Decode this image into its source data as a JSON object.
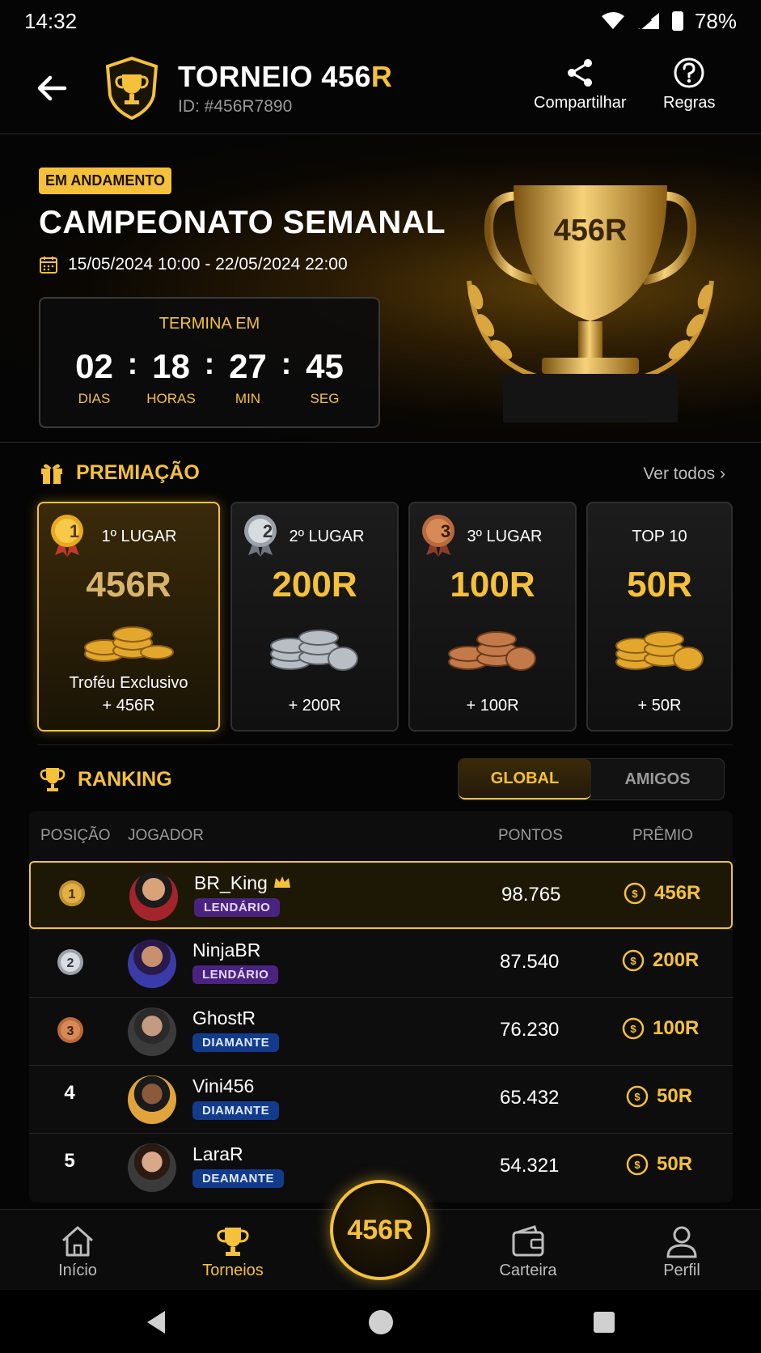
{
  "status": {
    "time": "14:32",
    "battery": "78%"
  },
  "header": {
    "title_main": "TORNEIO 456",
    "title_accent": "R",
    "id": "ID: #456R7890",
    "share_label": "Compartilhar",
    "rules_label": "Regras"
  },
  "hero": {
    "badge": "EM ANDAMENTO",
    "title": "CAMPEONATO SEMANAL",
    "dates": "15/05/2024 10:00 - 22/05/2024 22:00",
    "trophy_label": "456R",
    "countdown": {
      "label": "TERMINA EM",
      "days": "02",
      "days_label": "DIAS",
      "hours": "18",
      "hours_label": "HORAS",
      "minutes": "27",
      "minutes_label": "MIN",
      "seconds": "45",
      "seconds_label": "SEG",
      "sep": ":"
    }
  },
  "prizes": {
    "title": "PREMIAÇÃO",
    "see_all": "Ver todos",
    "cards": [
      {
        "medal": "1",
        "place": "1º LUGAR",
        "amount": "456R",
        "sub1": "Troféu Exclusivo",
        "sub2": "+ 456R"
      },
      {
        "medal": "2",
        "place": "2º LUGAR",
        "amount": "200R",
        "sub1": "+ 200R"
      },
      {
        "medal": "3",
        "place": "3º LUGAR",
        "amount": "100R",
        "sub1": "+ 100R"
      },
      {
        "place": "TOP 10",
        "amount": "50R",
        "sub1": "+ 50R"
      }
    ]
  },
  "ranking": {
    "title": "RANKING",
    "tabs": {
      "global": "GLOBAL",
      "friends": "AMIGOS",
      "active": "global"
    },
    "columns": {
      "position": "POSIÇÃO",
      "player": "JOGADOR",
      "points": "PONTOS",
      "prize": "PRÊMIO"
    },
    "rows": [
      {
        "position": "1",
        "name": "BR_King",
        "tier": "LENDÁRIO",
        "points": "98.765",
        "prize": "456R"
      },
      {
        "position": "2",
        "name": "NinjaBR",
        "tier": "LENDÁRIO",
        "points": "87.540",
        "prize": "200R"
      },
      {
        "position": "3",
        "name": "GhostR",
        "tier": "DIAMANTE",
        "points": "76.230",
        "prize": "100R"
      },
      {
        "position": "4",
        "name": "Vini456",
        "tier": "DIAMANTE",
        "points": "65.432",
        "prize": "50R"
      },
      {
        "position": "5",
        "name": "LaraR",
        "tier": "DEAMANTE",
        "points": "54.321",
        "prize": "50R"
      }
    ]
  },
  "nav": {
    "home": "Início",
    "tournaments": "Torneios",
    "center": "456R",
    "wallet": "Carteira",
    "profile": "Perfil"
  },
  "colors": {
    "gold": "#f5c13a",
    "background": "#050505",
    "legendary": "#4a2380",
    "diamond": "#123b8c"
  }
}
